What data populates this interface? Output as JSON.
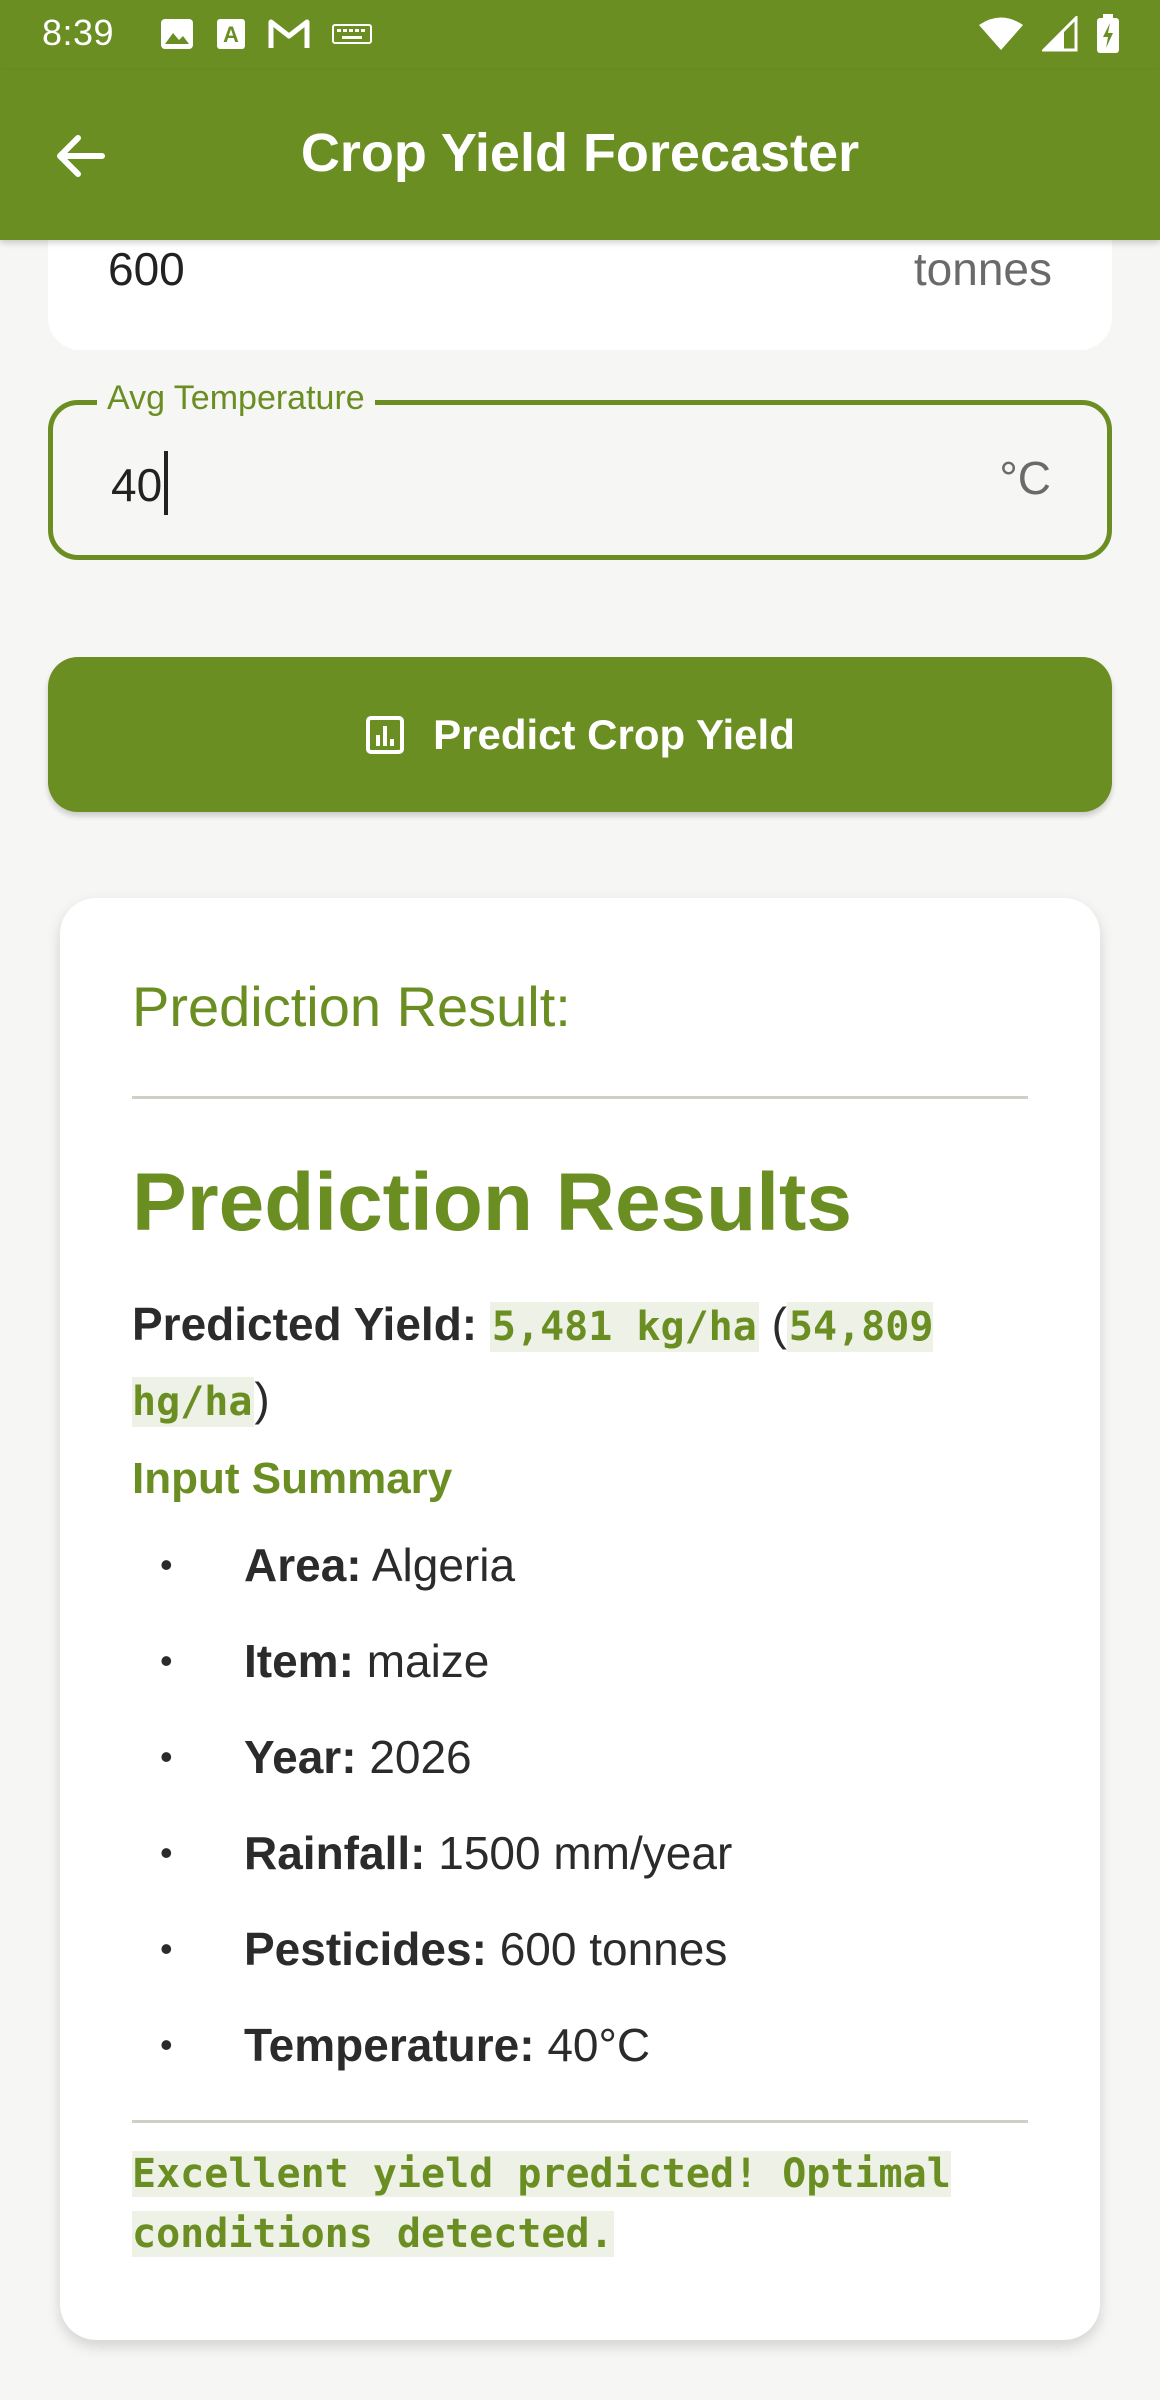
{
  "status_bar": {
    "time": "8:39",
    "left_icons": [
      "image-icon",
      "a-icon",
      "gmail-icon",
      "keyboard-icon"
    ],
    "right_icons": [
      "wifi-icon",
      "signal-icon",
      "battery-icon"
    ]
  },
  "app_bar": {
    "title": "Crop Yield Forecaster",
    "back_icon": "arrow-back-icon",
    "color": "#6b8e23"
  },
  "form": {
    "pesticides_value": "600",
    "pesticides_suffix": "tonnes",
    "temperature_label": "Avg Temperature",
    "temperature_value": "40",
    "temperature_suffix": "°C"
  },
  "predict_button": {
    "label": "Predict Crop Yield",
    "icon": "chart-icon"
  },
  "result": {
    "heading": "Prediction Result:",
    "title": "Prediction Results",
    "yield_label": "Predicted Yield:",
    "yield_kg": "5,481 kg/ha",
    "yield_hg": "54,809 hg/ha",
    "summary_title": "Input Summary",
    "summary": [
      {
        "key": "Area:",
        "value": "Algeria"
      },
      {
        "key": "Item:",
        "value": "maize"
      },
      {
        "key": "Year:",
        "value": "2026"
      },
      {
        "key": "Rainfall:",
        "value": "1500 mm/year"
      },
      {
        "key": "Pesticides:",
        "value": "600 tonnes"
      },
      {
        "key": "Temperature:",
        "value": "40°C"
      }
    ],
    "conclusion_line1": "Excellent yield predicted! Optimal",
    "conclusion_line2": "conditions detected."
  }
}
